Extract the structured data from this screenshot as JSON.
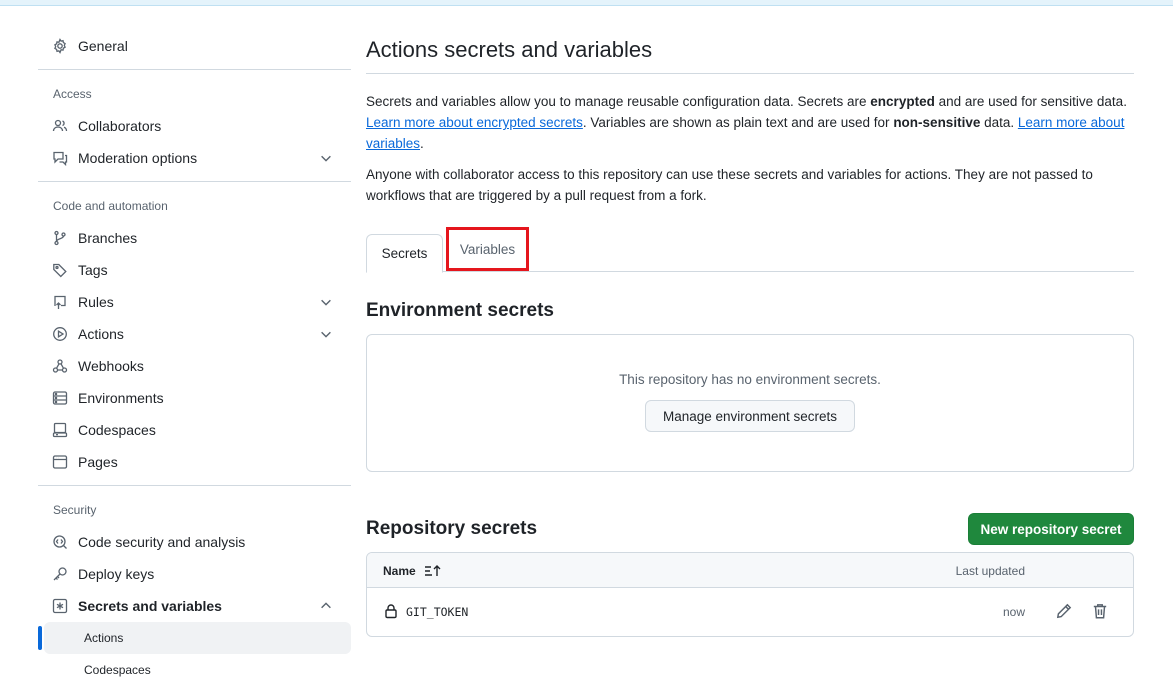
{
  "sidebar": {
    "general": "General",
    "access_heading": "Access",
    "collaborators": "Collaborators",
    "moderation": "Moderation options",
    "code_heading": "Code and automation",
    "branches": "Branches",
    "tags": "Tags",
    "rules": "Rules",
    "actions": "Actions",
    "webhooks": "Webhooks",
    "environments": "Environments",
    "codespaces": "Codespaces",
    "pages": "Pages",
    "security_heading": "Security",
    "code_security": "Code security and analysis",
    "deploy_keys": "Deploy keys",
    "secrets_vars": "Secrets and variables",
    "sub_actions": "Actions",
    "sub_codespaces": "Codespaces"
  },
  "main": {
    "title": "Actions secrets and variables",
    "intro": {
      "p1_a": "Secrets and variables allow you to manage reusable configuration data. Secrets are ",
      "p1_b": "encrypted",
      "p1_c": " and are used for sensitive data. ",
      "p1_link1": "Learn more about encrypted secrets",
      "p1_d": ". Variables are shown as plain text and are used for ",
      "p1_e": "non-sensitive",
      "p1_f": " data. ",
      "p1_link2": "Learn more about variables",
      "p1_g": ".",
      "p2": "Anyone with collaborator access to this repository can use these secrets and variables for actions. They are not passed to workflows that are triggered by a pull request from a fork."
    },
    "tabs": [
      "Secrets",
      "Variables"
    ],
    "env_title": "Environment secrets",
    "env_empty": "This repository has no environment secrets.",
    "env_button": "Manage environment secrets",
    "repo_title": "Repository secrets",
    "repo_button": "New repository secret",
    "table": {
      "col_name": "Name",
      "col_updated": "Last updated",
      "rows": [
        {
          "name": "GIT_TOKEN",
          "updated": "now"
        }
      ]
    }
  },
  "colors": {
    "accent": "#0969da",
    "primary_button": "#1f883d",
    "highlight_box": "#e5161d"
  }
}
